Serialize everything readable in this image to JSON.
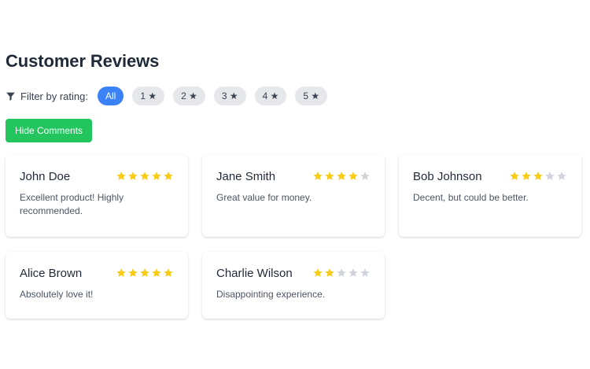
{
  "header": {
    "title": "Customer Reviews"
  },
  "filter": {
    "label": "Filter by rating:",
    "icon": "filter-icon",
    "chips": [
      {
        "label": "All",
        "active": true
      },
      {
        "label": "1 ★",
        "active": false
      },
      {
        "label": "2 ★",
        "active": false
      },
      {
        "label": "3 ★",
        "active": false
      },
      {
        "label": "4 ★",
        "active": false
      },
      {
        "label": "5 ★",
        "active": false
      }
    ]
  },
  "toggle": {
    "label": "Hide Comments"
  },
  "colors": {
    "accent_blue": "#3b82f6",
    "accent_green": "#22c55e",
    "star_filled": "#facc15",
    "star_empty": "#d1d5db"
  },
  "reviews": [
    {
      "name": "John Doe",
      "rating": 5,
      "comment": "Excellent product! Highly recommended."
    },
    {
      "name": "Jane Smith",
      "rating": 4,
      "comment": "Great value for money."
    },
    {
      "name": "Bob Johnson",
      "rating": 3,
      "comment": "Decent, but could be better."
    },
    {
      "name": "Alice Brown",
      "rating": 5,
      "comment": "Absolutely love it!"
    },
    {
      "name": "Charlie Wilson",
      "rating": 2,
      "comment": "Disappointing experience."
    }
  ]
}
